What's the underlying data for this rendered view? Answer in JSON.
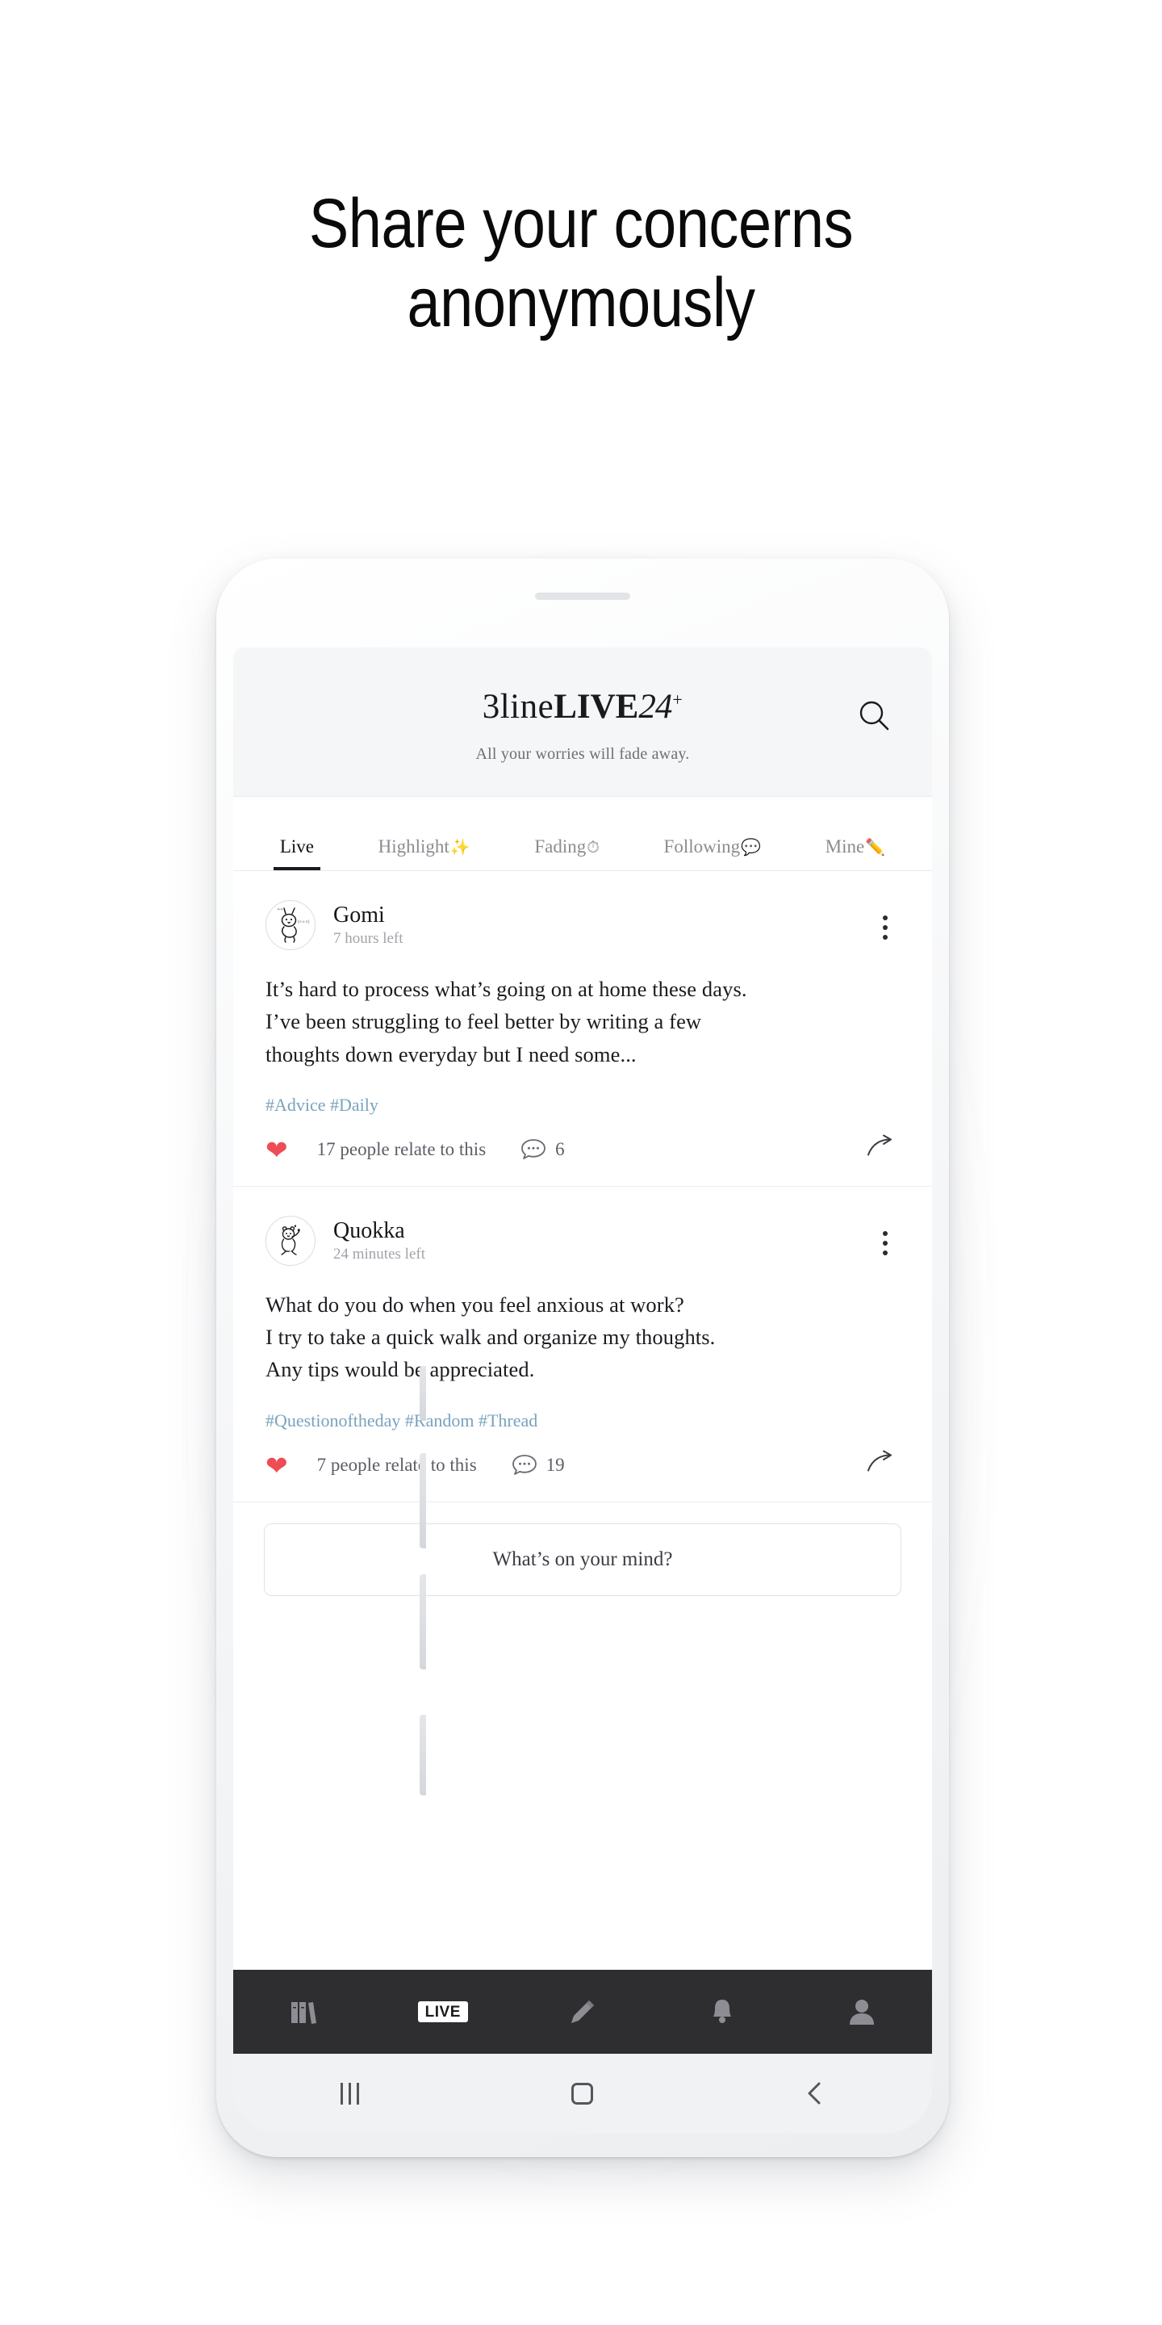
{
  "headline": {
    "line1": "Share your concerns",
    "line2": "anonymously"
  },
  "app": {
    "brand": {
      "part_light": "3line",
      "part_bold": "LIVE",
      "part_number": "24",
      "superscript": "+"
    },
    "tagline": "All your worries will fade away.",
    "search_icon": "search-icon"
  },
  "tabs": [
    {
      "label": "Live",
      "emoji": "",
      "active": true
    },
    {
      "label": "Highlight",
      "emoji": "✨",
      "active": false
    },
    {
      "label": "Fading",
      "emoji": "⏱",
      "active": false
    },
    {
      "label": "Following",
      "emoji": "💬",
      "active": false
    },
    {
      "label": "Mine",
      "emoji": "✏️",
      "active": false
    }
  ],
  "posts": [
    {
      "author": "Gomi",
      "expiry": "7 hours left",
      "avatar_icon": "rabbit-doodle-avatar",
      "body_line1": "It’s hard to process what’s going on at home these days.",
      "body_line2": "I’ve been struggling to feel better by writing a few",
      "body_line3": "thoughts down everyday but I need some...",
      "tags": "#Advice #Daily",
      "like_text": "17 people relate to this",
      "comment_count": "6",
      "heart_icon": "heart-icon",
      "comment_icon": "comment-icon",
      "share_icon": "share-icon",
      "more_icon": "more-options-icon"
    },
    {
      "author": "Quokka",
      "expiry": "24 minutes left",
      "avatar_icon": "quokka-doodle-avatar",
      "body_line1": "What do you do when you feel anxious at work?",
      "body_line2": "I try to take a quick walk and organize my thoughts.",
      "body_line3": "Any tips would be appreciated.",
      "tags": "#Questionoftheday #Random #Thread",
      "like_text": "7 people relate to this",
      "comment_count": "19",
      "heart_icon": "heart-icon",
      "comment_icon": "comment-icon",
      "share_icon": "share-icon",
      "more_icon": "more-options-icon"
    }
  ],
  "composer": {
    "placeholder": "What’s on your mind?"
  },
  "bottom_nav": [
    {
      "name": "books-icon",
      "label": ""
    },
    {
      "name": "live-badge-icon",
      "label": "LIVE"
    },
    {
      "name": "pencil-icon",
      "label": ""
    },
    {
      "name": "bell-icon",
      "label": ""
    },
    {
      "name": "person-icon",
      "label": ""
    }
  ],
  "system_nav": [
    {
      "name": "recents-icon"
    },
    {
      "name": "home-icon"
    },
    {
      "name": "back-icon"
    }
  ],
  "colors": {
    "accent_heart": "#ee4d56",
    "tag_blue": "#79a3bd",
    "nav_dark": "#2e2e30",
    "header_bg": "#f5f6f7"
  }
}
